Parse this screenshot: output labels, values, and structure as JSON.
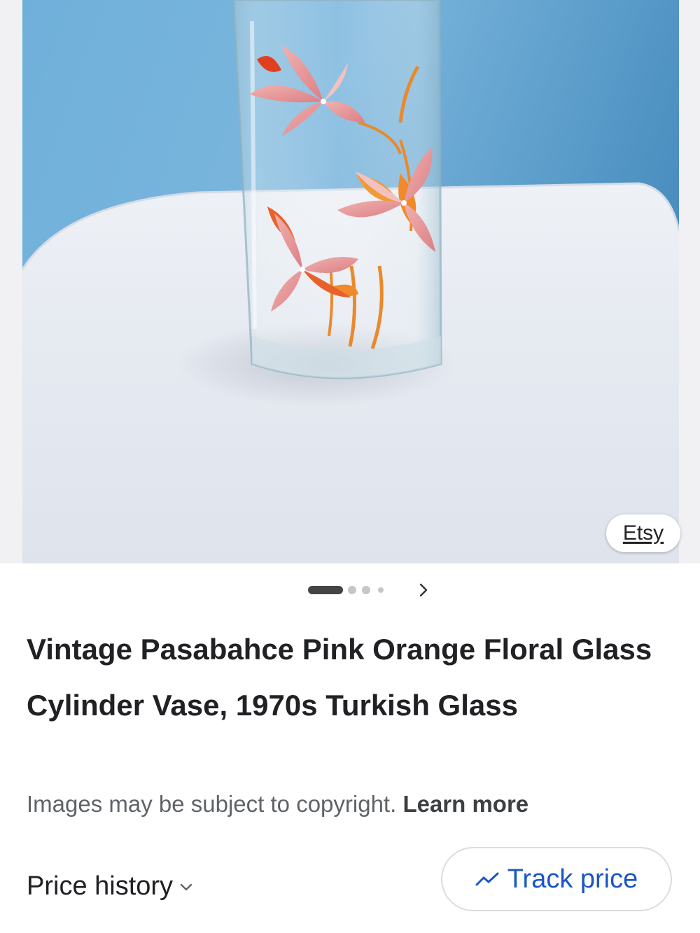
{
  "image": {
    "alt": "Vintage Pasabahce Pink Orange Floral Glass Cylinder Vase",
    "source_label": "Etsy"
  },
  "carousel": {
    "total_dots": 4,
    "active_index": 0,
    "next_icon": "chevron-right-icon"
  },
  "product": {
    "title": "Vintage Pasabahce Pink Orange Floral Glass Cylinder Vase, 1970s Turkish Glass"
  },
  "notice": {
    "text": "Images may be subject to copyright.",
    "link": "Learn more"
  },
  "actions": {
    "price_history": "Price history",
    "price_history_icon": "chevron-down-icon",
    "track_price": "Track price",
    "track_price_icon": "trend-icon"
  },
  "colors": {
    "link": "#1a56c4",
    "text": "#202124",
    "muted": "#5f6368",
    "wall": "#7ab3d6"
  }
}
